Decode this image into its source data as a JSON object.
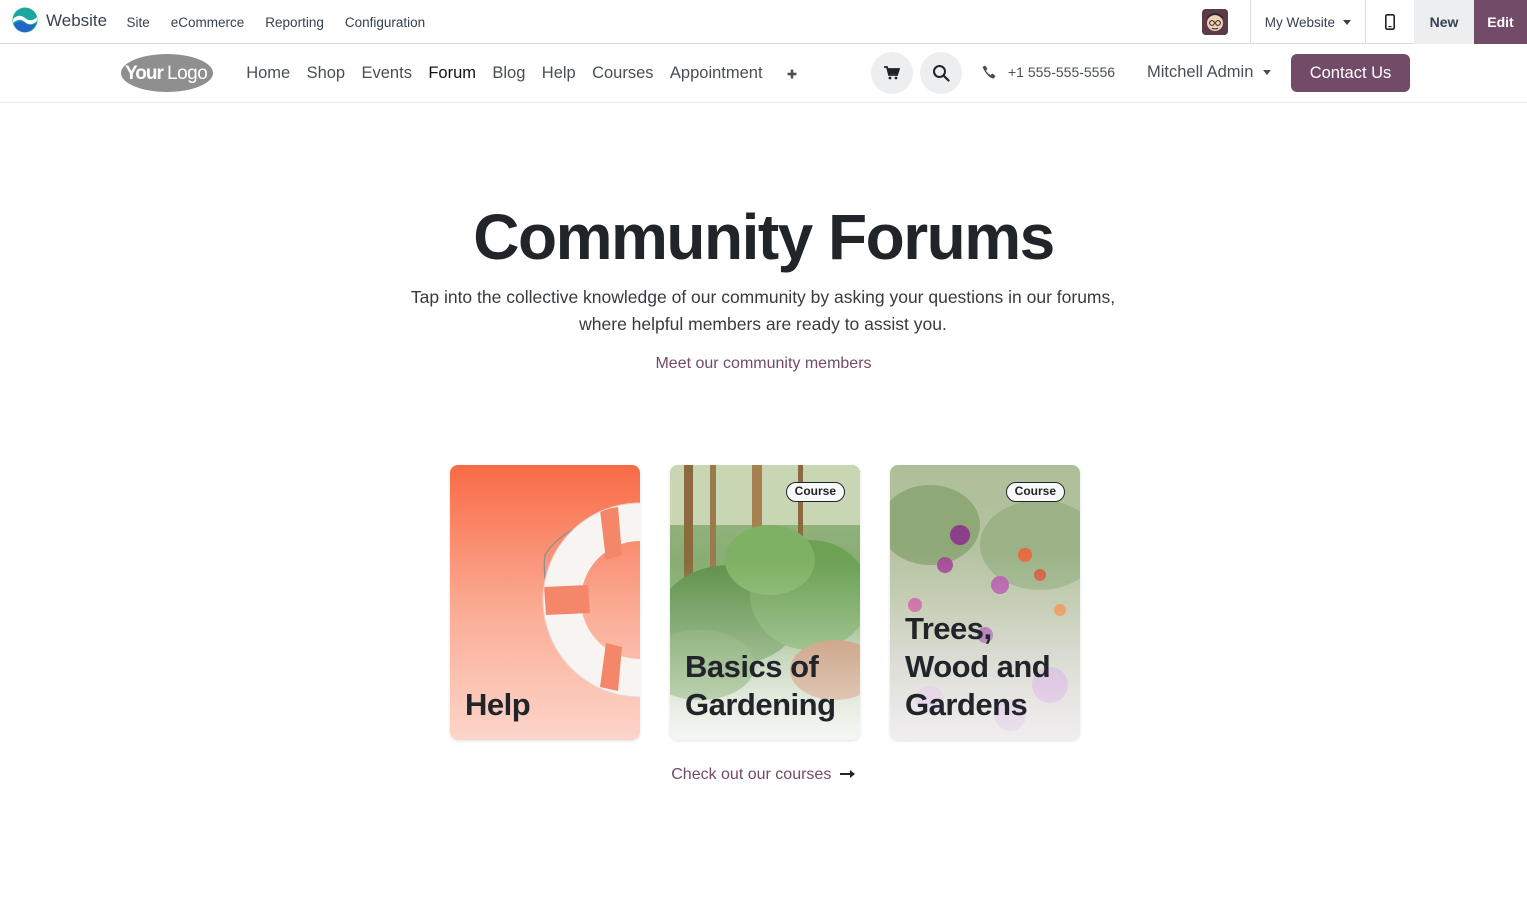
{
  "adminbar": {
    "app_name": "Website",
    "menu": [
      "Site",
      "eCommerce",
      "Reporting",
      "Configuration"
    ],
    "website_selector": "My Website",
    "new_label": "New",
    "edit_label": "Edit"
  },
  "header": {
    "logo_text": "YourLogo",
    "nav": [
      "Home",
      "Shop",
      "Events",
      "Forum",
      "Blog",
      "Help",
      "Courses",
      "Appointment"
    ],
    "active_nav": "Forum",
    "phone": "+1 555-555-5556",
    "user": "Mitchell Admin",
    "contact_label": "Contact Us"
  },
  "hero": {
    "title": "Community Forums",
    "subtitle_line1": "Tap into the collective knowledge of our community by asking your questions in our forums,",
    "subtitle_line2": "where helpful members are ready to assist you.",
    "meet_link": "Meet our community members"
  },
  "forums": [
    {
      "title": "Help",
      "badge": ""
    },
    {
      "title_line1": "Basics of",
      "title_line2": "Gardening",
      "badge": "Course"
    },
    {
      "title_line1": "Trees,",
      "title_line2": "Wood and",
      "title_line3": "Gardens",
      "badge": "Course"
    }
  ],
  "courses_link": "Check out our courses",
  "colors": {
    "brand": "#714b67",
    "help_card": "#f97a59"
  },
  "icons": [
    "cart-icon",
    "search-icon",
    "phone-icon",
    "mobile-icon",
    "plus-icon",
    "arrow-right-icon"
  ]
}
